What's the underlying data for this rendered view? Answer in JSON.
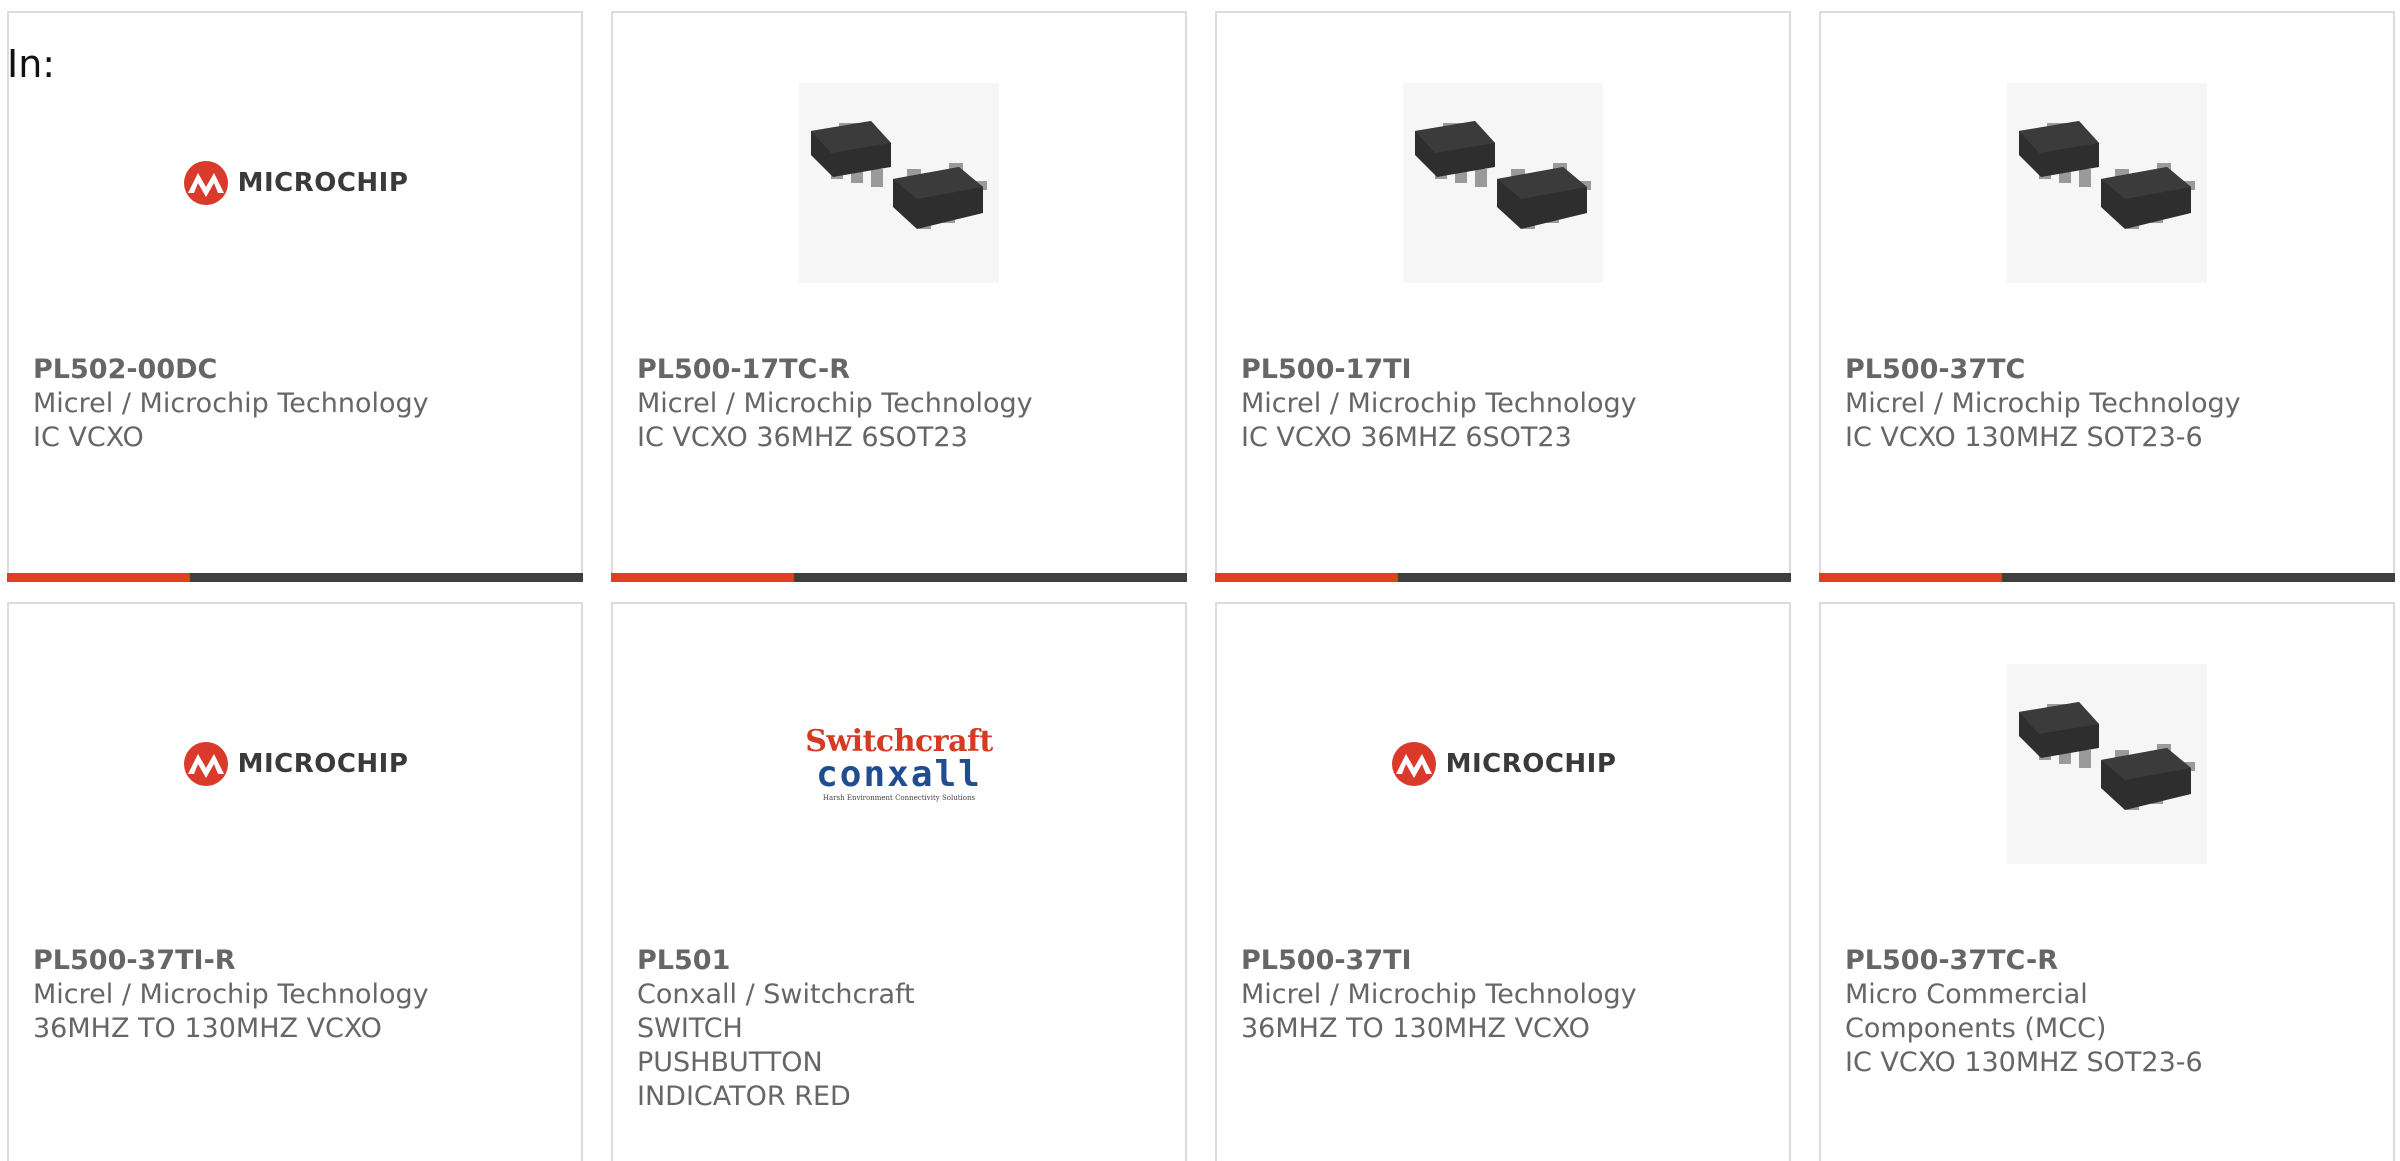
{
  "header": {
    "in_label": "In:"
  },
  "colors": {
    "accent": "#e2401c",
    "bar": "#3f3f3f",
    "text": "#666666",
    "border": "#dcdcdc",
    "microchip_red": "#d93a2b",
    "switchcraft_red": "#d63a23",
    "conxall_blue": "#1f4d8f"
  },
  "logos": {
    "microchip_word": "MICROCHIP",
    "switchcraft_top": "Switchcraft",
    "switchcraft_mid": "conxall",
    "switchcraft_tag": "Harsh Environment Connectivity Solutions"
  },
  "products": [
    {
      "part": "PL502-00DC",
      "manufacturer": "Micrel / Microchip Technology",
      "description": "IC VCXO",
      "image": "microchip-logo"
    },
    {
      "part": "PL500-17TC-R",
      "manufacturer": "Micrel / Microchip Technology",
      "description": "IC VCXO 36MHZ 6SOT23",
      "image": "sot23-chip-photo"
    },
    {
      "part": "PL500-17TI",
      "manufacturer": "Micrel / Microchip Technology",
      "description": "IC VCXO 36MHZ 6SOT23",
      "image": "sot23-chip-photo"
    },
    {
      "part": "PL500-37TC",
      "manufacturer": "Micrel / Microchip Technology",
      "description": "IC VCXO 130MHZ SOT23-6",
      "image": "sot23-chip-photo"
    },
    {
      "part": "PL500-37TI-R",
      "manufacturer": "Micrel / Microchip Technology",
      "description": "36MHZ TO 130MHZ VCXO",
      "image": "microchip-logo"
    },
    {
      "part": "PL501",
      "manufacturer": "Conxall / Switchcraft",
      "description": "SWITCH PUSHBUTTON INDICATOR RED",
      "image": "switchcraft-conxall-logo"
    },
    {
      "part": "PL500-37TI",
      "manufacturer": "Micrel / Microchip Technology",
      "description": "36MHZ TO 130MHZ VCXO",
      "image": "microchip-logo"
    },
    {
      "part": "PL500-37TC-R",
      "manufacturer": "Micro Commercial Components (MCC)",
      "description": "IC VCXO 130MHZ SOT23-6",
      "image": "sot23-chip-photo"
    }
  ]
}
